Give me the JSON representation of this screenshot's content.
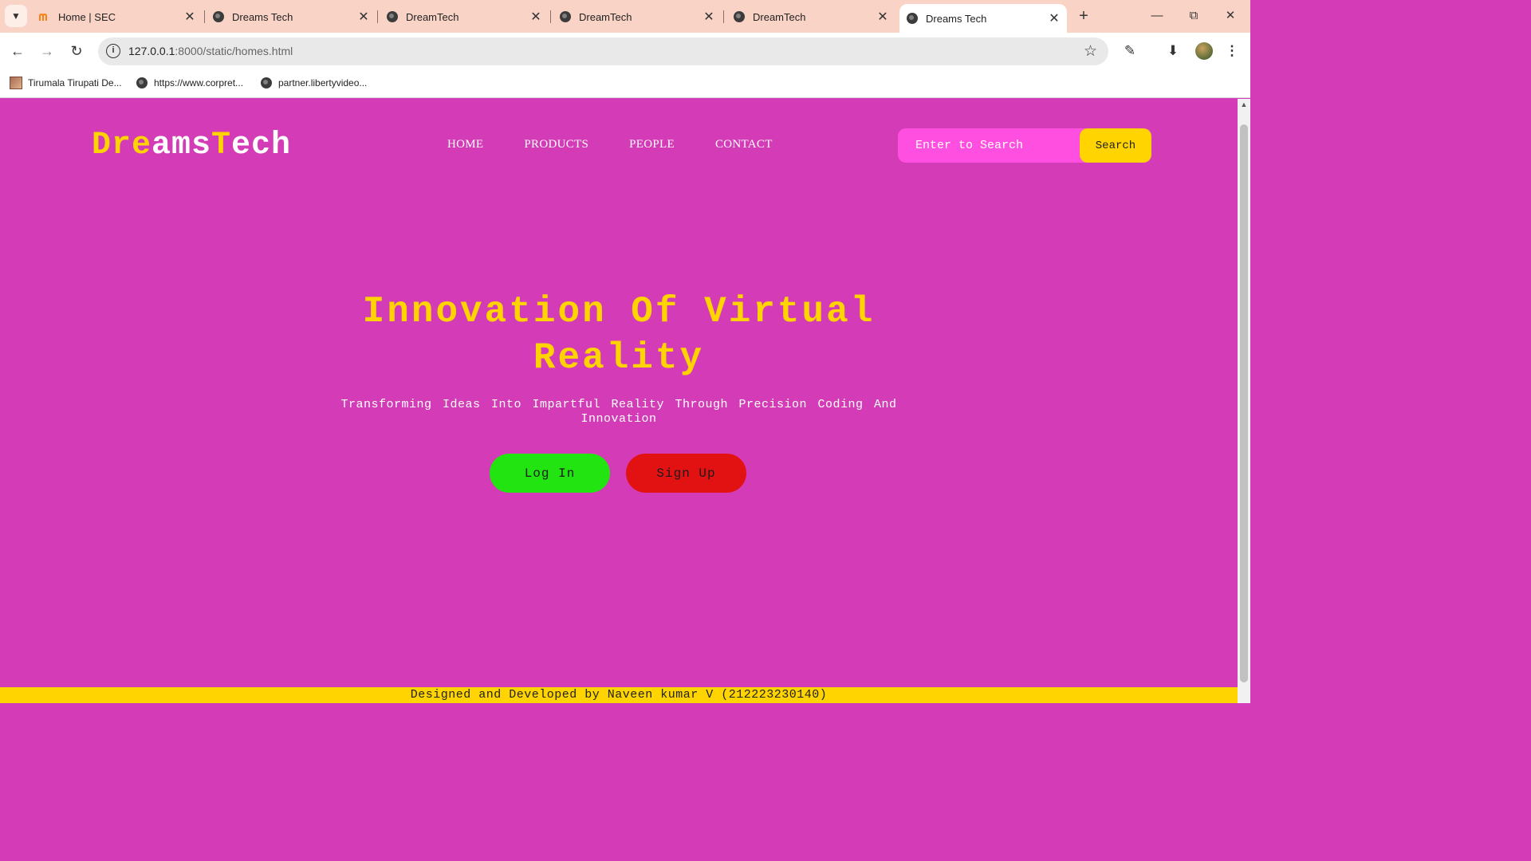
{
  "browser": {
    "tabs": [
      {
        "title": "Home | SEC",
        "icon": "moodle-icon"
      },
      {
        "title": "Dreams Tech",
        "icon": "globe-icon"
      },
      {
        "title": "DreamTech",
        "icon": "globe-icon"
      },
      {
        "title": "DreamTech",
        "icon": "globe-icon"
      },
      {
        "title": "DreamTech",
        "icon": "globe-icon"
      },
      {
        "title": "Dreams Tech",
        "icon": "globe-icon",
        "active": true
      }
    ],
    "url_host": "127.0.0.1",
    "url_rest": ":8000/static/homes.html",
    "bookmarks": [
      {
        "label": "Tirumala Tirupati De...",
        "icon": "temple-icon"
      },
      {
        "label": "https://www.corpret...",
        "icon": "globe-icon"
      },
      {
        "label": "partner.libertyvideo...",
        "icon": "globe-icon"
      }
    ]
  },
  "page": {
    "logo": {
      "part1": "Dre",
      "part2": "ams",
      "part3": "T",
      "part4": "ech"
    },
    "nav": [
      "HOME",
      "PRODUCTS",
      "PEOPLE",
      "CONTACT"
    ],
    "search": {
      "placeholder": "Enter to Search",
      "button": "Search"
    },
    "hero": {
      "title": "Innovation Of Virtual Reality",
      "subtitle": "Transforming Ideas Into Impartful Reality Through Precision Coding And Innovation"
    },
    "buttons": {
      "login": "Log In",
      "signup": "Sign Up"
    },
    "footer": "Designed and Developed by Naveen kumar V (212223230140)",
    "colors": {
      "background": "#d33cb6",
      "accent": "#ffd400",
      "login": "#22e410",
      "signup": "#e31212",
      "search_field": "#ff4fe0"
    }
  }
}
